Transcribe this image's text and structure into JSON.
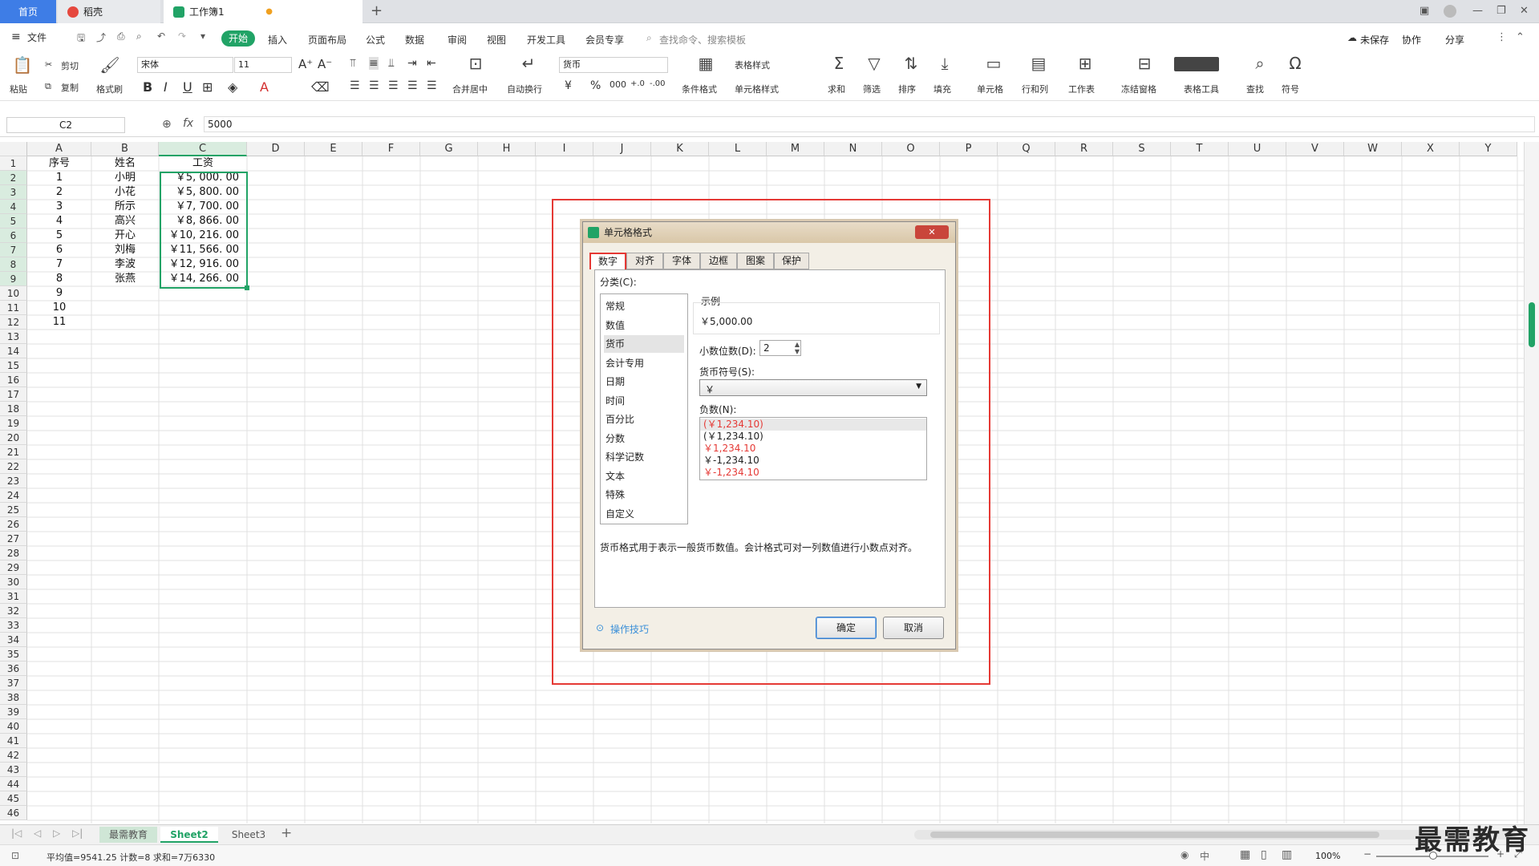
{
  "tabs": {
    "home": "首页",
    "daoke": "稻壳",
    "book": "工作簿1"
  },
  "menu": {
    "file": "文件",
    "start": "开始",
    "items": [
      "插入",
      "页面布局",
      "公式",
      "数据",
      "审阅",
      "视图",
      "开发工具",
      "会员专享"
    ],
    "search_placeholder": "查找命令、搜索模板",
    "unsaved": "未保存",
    "collab": "协作",
    "share": "分享"
  },
  "ribbon": {
    "paste": "粘贴",
    "cut": "剪切",
    "copy": "复制",
    "format_painter": "格式刷",
    "font_name": "宋体",
    "font_size": "11",
    "merge_center": "合并居中",
    "wrap_text": "自动换行",
    "number_format": "货币",
    "cond_format": "条件格式",
    "table_style": "表格样式",
    "cell_style": "单元格样式",
    "sum": "求和",
    "filter": "筛选",
    "sort": "排序",
    "fill": "填充",
    "cell": "单元格",
    "row_col": "行和列",
    "worksheet": "工作表",
    "freeze": "冻结窗格",
    "table_tools": "表格工具",
    "find": "查找",
    "symbol": "符号"
  },
  "formula_bar": {
    "name_box": "C2",
    "fx": "fx",
    "value": "5000"
  },
  "grid": {
    "columns": [
      "A",
      "B",
      "C",
      "D",
      "E",
      "F",
      "G",
      "H",
      "I",
      "J",
      "K",
      "L",
      "M",
      "N",
      "O",
      "P",
      "Q",
      "R",
      "S",
      "T",
      "U",
      "V",
      "W",
      "X",
      "Y"
    ],
    "row_count": 46,
    "headers": [
      "序号",
      "姓名",
      "工资"
    ],
    "rows": [
      {
        "a": "1",
        "b": "小明",
        "c": "￥5, 000. 00"
      },
      {
        "a": "2",
        "b": "小花",
        "c": "￥5, 800. 00"
      },
      {
        "a": "3",
        "b": "所示",
        "c": "￥7, 700. 00"
      },
      {
        "a": "4",
        "b": "高兴",
        "c": "￥8, 866. 00"
      },
      {
        "a": "5",
        "b": "开心",
        "c": "￥10, 216. 00"
      },
      {
        "a": "6",
        "b": "刘梅",
        "c": "￥11, 566. 00"
      },
      {
        "a": "7",
        "b": "李波",
        "c": "￥12, 916. 00"
      },
      {
        "a": "8",
        "b": "张燕",
        "c": "￥14, 266. 00"
      },
      {
        "a": "9",
        "b": "",
        "c": ""
      },
      {
        "a": "10",
        "b": "",
        "c": ""
      },
      {
        "a": "11",
        "b": "",
        "c": ""
      }
    ]
  },
  "dialog": {
    "title": "单元格格式",
    "tabs": [
      "数字",
      "对齐",
      "字体",
      "边框",
      "图案",
      "保护"
    ],
    "category_label": "分类(C):",
    "categories": [
      "常规",
      "数值",
      "货币",
      "会计专用",
      "日期",
      "时间",
      "百分比",
      "分数",
      "科学记数",
      "文本",
      "特殊",
      "自定义"
    ],
    "selected_category": "货币",
    "sample_label": "示例",
    "sample_value": "￥5,000.00",
    "decimal_label": "小数位数(D):",
    "decimal_value": "2",
    "currency_label": "货币符号(S):",
    "currency_value": "￥",
    "negative_label": "负数(N):",
    "negatives": [
      "(￥1,234.10)",
      "(￥1,234.10)",
      "￥1,234.10",
      "￥-1,234.10",
      "￥-1,234.10"
    ],
    "description": "货币格式用于表示一般货币数值。会计格式可对一列数值进行小数点对齐。",
    "tips": "操作技巧",
    "ok": "确定",
    "cancel": "取消"
  },
  "sheets": [
    "最需教育",
    "Sheet2",
    "Sheet3"
  ],
  "status": {
    "summary": "平均值=9541.25  计数=8  求和=7万6330",
    "zoom": "100%"
  },
  "watermark": "最需教育"
}
